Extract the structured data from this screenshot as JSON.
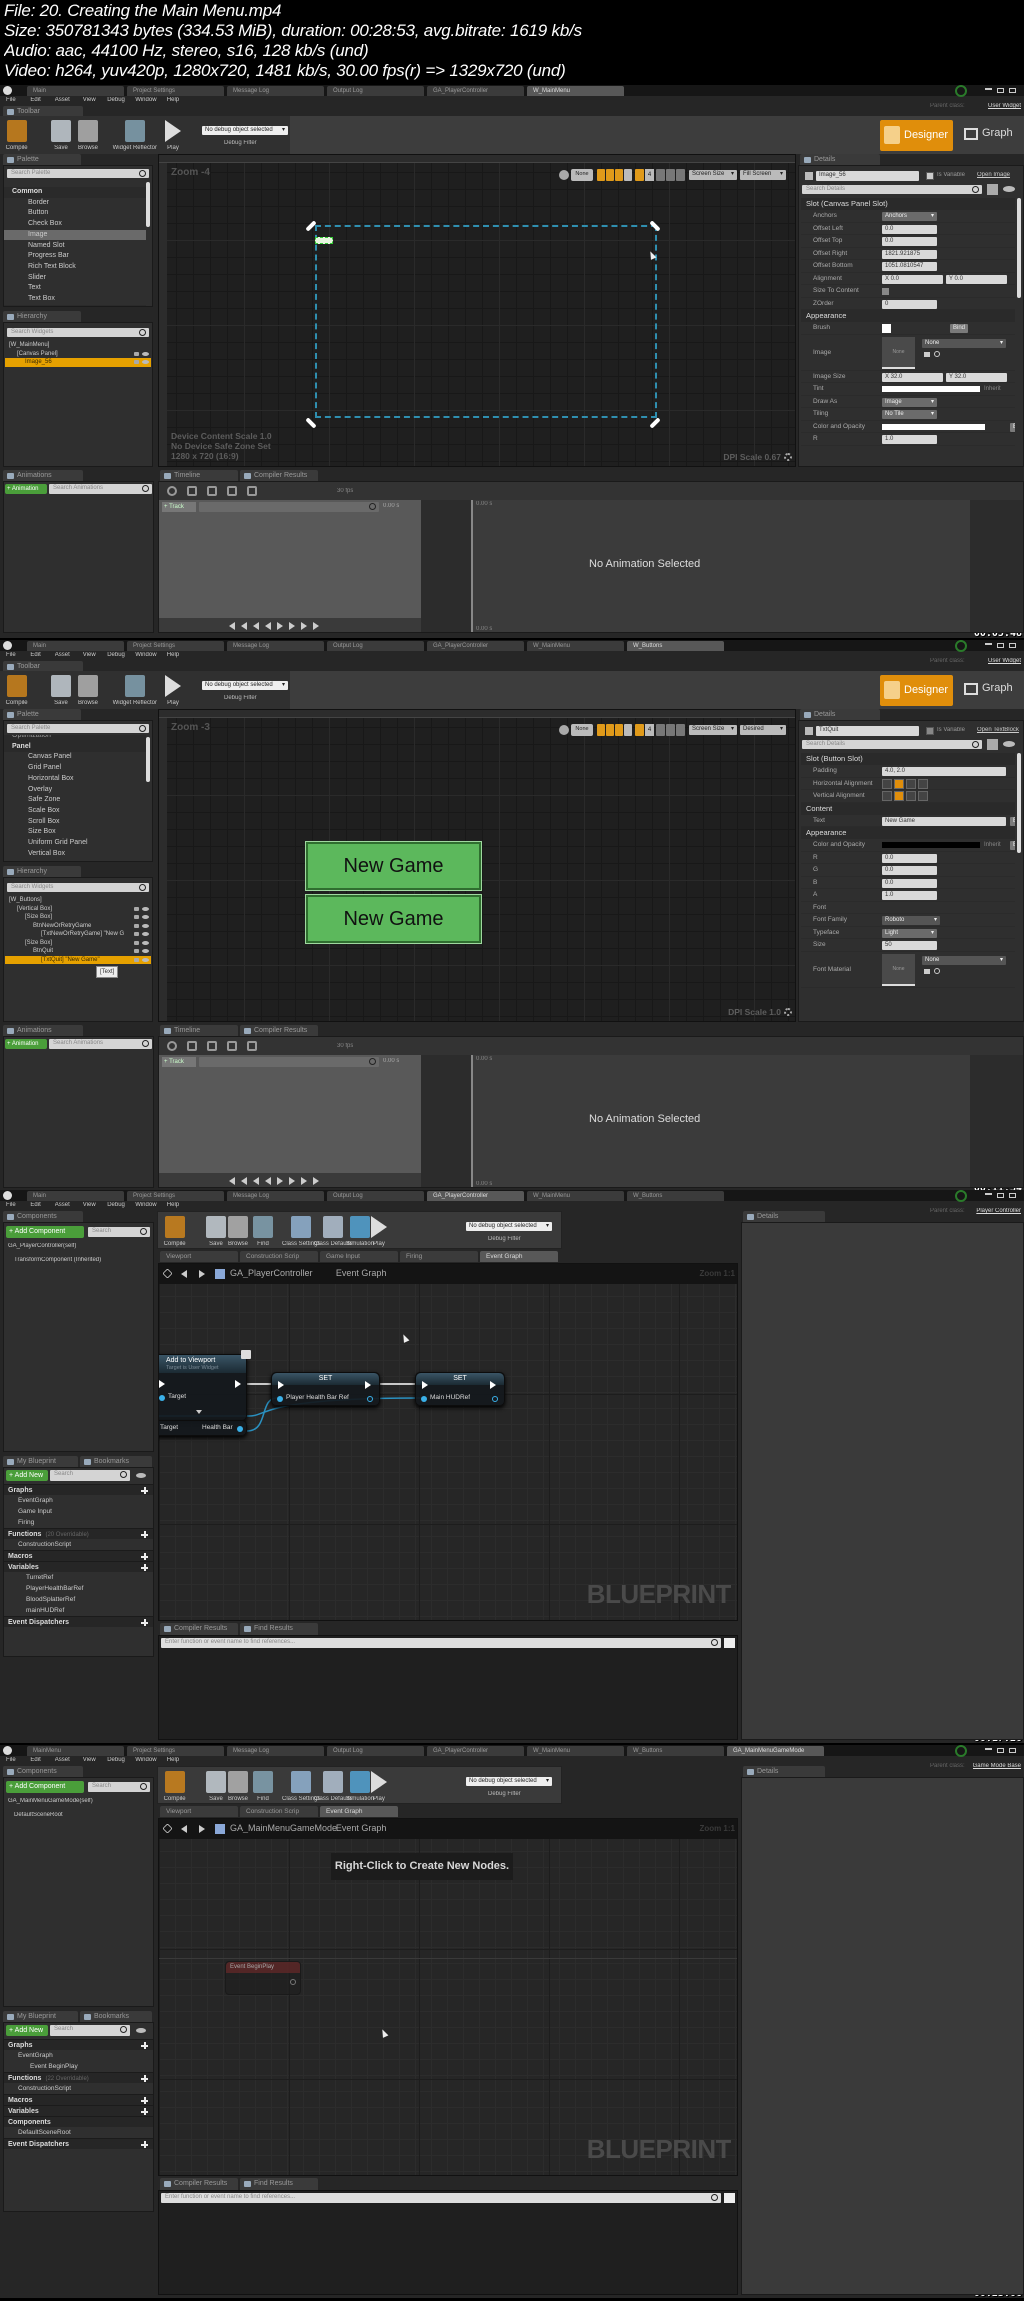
{
  "header": {
    "lines": [
      "File: 20. Creating the Main Menu.mp4",
      "Size: 350781343 bytes (334.53 MiB), duration: 00:28:53, avg.bitrate: 1619 kb/s",
      "Audio: aac, 44100 Hz, stereo, s16, 128 kb/s (und)",
      "Video: h264, yuv420p, 1280x720, 1481 kb/s, 30.00 fps(r) => 1329x720 (und)"
    ]
  },
  "colors": {
    "accent_orange": "#e6a100",
    "button_green": "#5cb85c",
    "pin_blue": "#3ab0e8",
    "selection_dashed": "#2f8fb0"
  },
  "frames": [
    {
      "type": "widget",
      "timestamp": "00:05:48",
      "app_tabs": [
        "Main",
        "Project Settings",
        "Message Log",
        "Output Log",
        "GA_PlayerController",
        "W_MainMenu"
      ],
      "active_tab": 5,
      "menu": [
        "File",
        "Edit",
        "Asset",
        "View",
        "Debug",
        "Window",
        "Help"
      ],
      "parent_class_label": "Parent class:",
      "parent_class": "User Widget",
      "toolbar_tab": "Toolbar",
      "toolbar": [
        "Compile",
        "Save",
        "Browse",
        "Widget Reflector",
        "Play"
      ],
      "debug_dropdown": "No debug object selected",
      "debug_filter": "Debug Filter",
      "modes": {
        "designer": "Designer",
        "graph": "Graph"
      },
      "palette": {
        "tab": "Palette",
        "search": "Search Palette",
        "pre_category": "",
        "category": "Common",
        "items": [
          "Border",
          "Button",
          "Check Box",
          "Image",
          "Named Slot",
          "Progress Bar",
          "Rich Text Block",
          "Slider",
          "Text",
          "Text Box"
        ],
        "selected": 3,
        "next_category": "Input"
      },
      "hierarchy": {
        "tab": "Hierarchy",
        "search": "Search Widgets",
        "tree": [
          {
            "label": "[W_MainMenu]",
            "depth": 0
          },
          {
            "label": "[Canvas Panel]",
            "depth": 1
          },
          {
            "label": "Image_56",
            "depth": 2,
            "selected": true
          }
        ],
        "tooltip": ""
      },
      "canvas": {
        "zoom": "Zoom -4",
        "tools": [
          "None",
          "4",
          "Screen Size",
          "Fill Screen"
        ],
        "info": [
          "Device Content Scale 1.0",
          "No Device Safe Zone Set",
          "1280 x 720 (16:9)"
        ],
        "dpi": "DPI Scale 0.67",
        "buttons": []
      },
      "details": {
        "tab": "Details",
        "name": "Image_56",
        "is_variable": "Is Variable",
        "is_variable_checked": true,
        "open_label": "Open Image",
        "search": "Search Details",
        "rows": [
          {
            "section": "Slot (Canvas Panel Slot)"
          },
          {
            "label": "Anchors",
            "kind": "dropdown",
            "values": [
              "Anchors"
            ]
          },
          {
            "label": "Offset Left",
            "kind": "input",
            "values": [
              "0.0"
            ]
          },
          {
            "label": "Offset Top",
            "kind": "input",
            "values": [
              "0.0"
            ]
          },
          {
            "label": "Offset Right",
            "kind": "input",
            "values": [
              "1821.921875"
            ]
          },
          {
            "label": "Offset Bottom",
            "kind": "input",
            "values": [
              "1051.0810547"
            ]
          },
          {
            "label": "Alignment",
            "kind": "input2",
            "values": [
              "X  0.0",
              "Y  0.0"
            ]
          },
          {
            "label": "Size To Content",
            "kind": "check",
            "values": []
          },
          {
            "label": "ZOrder",
            "kind": "input",
            "values": [
              "0"
            ]
          },
          {
            "section": "Appearance"
          },
          {
            "label": "Brush",
            "kind": "swatch",
            "values": [],
            "bind": "Bind"
          },
          {
            "label": "Image",
            "kind": "thumb",
            "values": [
              "None",
              "None"
            ]
          },
          {
            "label": "Image Size",
            "kind": "input2",
            "values": [
              "X  32.0",
              "Y  32.0"
            ]
          },
          {
            "label": "Tint",
            "kind": "bar-white",
            "values": [],
            "inherit": "Inherit"
          },
          {
            "label": "Draw As",
            "kind": "dropdown",
            "values": [
              "Image"
            ]
          },
          {
            "label": "Tiling",
            "kind": "dropdown",
            "values": [
              "No Tile"
            ]
          },
          {
            "label": "Color and Opacity",
            "kind": "bar-white",
            "values": [],
            "bind": "Bind"
          },
          {
            "label": "R",
            "kind": "input",
            "values": [
              "1.0"
            ]
          }
        ]
      },
      "animations": {
        "tab": "Animations",
        "add": "+ Animation",
        "search": "Search Animations"
      },
      "timeline": {
        "tabs": [
          "Timeline",
          "Compiler Results"
        ],
        "fps": "30 fps",
        "track": "+ Track",
        "time": "0.00 s",
        "empty": "No Animation Selected"
      }
    },
    {
      "type": "widget",
      "timestamp": "00:11:34",
      "app_tabs": [
        "Main",
        "Project Settings",
        "Message Log",
        "Output Log",
        "GA_PlayerController",
        "W_MainMenu",
        "W_Buttons"
      ],
      "active_tab": 6,
      "menu": [
        "File",
        "Edit",
        "Asset",
        "View",
        "Debug",
        "Window",
        "Help"
      ],
      "parent_class_label": "Parent class:",
      "parent_class": "User Widget",
      "toolbar_tab": "Toolbar",
      "toolbar": [
        "Compile",
        "Save",
        "Browse",
        "Widget Reflector",
        "Play"
      ],
      "debug_dropdown": "No debug object selected",
      "debug_filter": "Debug Filter",
      "modes": {
        "designer": "Designer",
        "graph": "Graph"
      },
      "palette": {
        "tab": "Palette",
        "search": "Search Palette",
        "pre_category": "Optimization",
        "category": "Panel",
        "items": [
          "Canvas Panel",
          "Grid Panel",
          "Horizontal Box",
          "Overlay",
          "Safe Zone",
          "Scale Box",
          "Scroll Box",
          "Size Box",
          "Uniform Grid Panel",
          "Vertical Box"
        ],
        "selected": -1,
        "next_category": ""
      },
      "hierarchy": {
        "tab": "Hierarchy",
        "search": "Search Widgets",
        "tree": [
          {
            "label": "[W_Buttons]",
            "depth": 0
          },
          {
            "label": "[Vertical Box]",
            "depth": 1
          },
          {
            "label": "[Size Box]",
            "depth": 2
          },
          {
            "label": "BtnNewOrRetryGame",
            "depth": 3
          },
          {
            "label": "[TxtNewOrRetryGame] \"New G",
            "depth": 4
          },
          {
            "label": "[Size Box]",
            "depth": 2
          },
          {
            "label": "BtnQuit",
            "depth": 3
          },
          {
            "label": "[TxtQuit] \"New Game\"",
            "depth": 4,
            "selected": true
          }
        ],
        "tooltip": "[Text]"
      },
      "canvas": {
        "zoom": "Zoom -3",
        "tools": [
          "None",
          "4",
          "Screen Size",
          "Desired"
        ],
        "info": [],
        "dpi": "DPI Scale 1.0",
        "buttons": [
          "New Game",
          "New Game"
        ]
      },
      "details": {
        "tab": "Details",
        "name": "TxtQuit",
        "is_variable": "Is Variable",
        "is_variable_checked": false,
        "open_label": "Open TextBlock",
        "search": "Search Details",
        "rows": [
          {
            "section": "Slot (Button Slot)"
          },
          {
            "label": "Padding",
            "kind": "wide",
            "values": [
              "4.0, 2.0"
            ]
          },
          {
            "label": "Horizontal Alignment",
            "kind": "align",
            "values": [],
            "active": 1
          },
          {
            "label": "Vertical Alignment",
            "kind": "align",
            "values": [],
            "active": 1
          },
          {
            "section": "Content"
          },
          {
            "label": "Text",
            "kind": "wide",
            "values": [
              "New Game"
            ],
            "bind": "Bind"
          },
          {
            "section": "Appearance"
          },
          {
            "label": "Color and Opacity",
            "kind": "bar-black",
            "values": [],
            "inherit": "Inherit",
            "bind": "Bind"
          },
          {
            "label": "R",
            "kind": "input",
            "values": [
              "0.0"
            ]
          },
          {
            "label": "G",
            "kind": "input",
            "values": [
              "0.0"
            ]
          },
          {
            "label": "B",
            "kind": "input",
            "values": [
              "0.0"
            ]
          },
          {
            "label": "A",
            "kind": "input",
            "values": [
              "1.0"
            ]
          },
          {
            "label": "Font",
            "kind": "none",
            "values": []
          },
          {
            "label": "Font Family",
            "kind": "dropdown-dark",
            "values": [
              "Roboto"
            ]
          },
          {
            "label": "Typeface",
            "kind": "dropdown",
            "values": [
              "Light"
            ]
          },
          {
            "label": "Size",
            "kind": "input",
            "values": [
              "50"
            ]
          },
          {
            "label": "Font Material",
            "kind": "thumb",
            "values": [
              "None",
              "None"
            ]
          }
        ]
      },
      "animations": {
        "tab": "Animations",
        "add": "+ Animation",
        "search": "Search Animations"
      },
      "timeline": {
        "tabs": [
          "Timeline",
          "Compiler Results"
        ],
        "fps": "30 fps",
        "track": "+ Track",
        "time": "0.00 s",
        "empty": "No Animation Selected"
      }
    },
    {
      "type": "blueprint",
      "timestamp": "00:17:20",
      "app_tabs": [
        "Main",
        "Project Settings",
        "Message Log",
        "Output Log",
        "GA_PlayerController",
        "W_MainMenu",
        "W_Buttons"
      ],
      "active_tab": 4,
      "menu": [
        "File",
        "Edit",
        "Asset",
        "View",
        "Debug",
        "Window",
        "Help"
      ],
      "parent_class_label": "Parent class:",
      "parent_class": "Player Controller",
      "toolbar": [
        "Compile",
        "Save",
        "Browse",
        "Find",
        "Class Settings",
        "Class Defaults",
        "Simulation",
        "Play"
      ],
      "debug_dropdown": "No debug object selected",
      "debug_filter": "Debug Filter",
      "components": {
        "tab": "Components",
        "add": "+ Add Component",
        "search": "Search",
        "items": [
          "GA_PlayerController(self)",
          "TransformComponent (Inherited)"
        ]
      },
      "my_blueprint": {
        "tab": "My Blueprint",
        "bookmarks": "Bookmarks",
        "add": "+ Add New",
        "search": "Search",
        "sections": [
          {
            "title": "Graphs",
            "items": [
              "EventGraph",
              "Game Input",
              "Firing"
            ]
          },
          {
            "title": "Functions",
            "note": "(20 Overridable)",
            "items": [
              "ConstructionScript"
            ]
          },
          {
            "title": "Macros",
            "items": []
          },
          {
            "title": "Variables",
            "items": [
              "TurretRef",
              "PlayerHealthBarRef",
              "BloodSplatterRef",
              "mainHUDRef"
            ]
          },
          {
            "title": "Event Dispatchers",
            "items": []
          }
        ]
      },
      "graph_tabs": [
        "Viewport",
        "Construction Scrip",
        "Game Input",
        "Firing",
        "Event Graph"
      ],
      "active_graph_tab": 4,
      "breadcrumb": [
        "GA_PlayerController",
        "Event Graph"
      ],
      "zoom": "Zoom 1:1",
      "watermark": "BLUEPRINT",
      "hint": "",
      "nodes": {
        "add_to_viewport": {
          "title": "Add to Viewport",
          "subtitle": "Target is User Widget",
          "pin": "Target"
        },
        "health": {
          "left": "Target",
          "right": "Health Bar"
        },
        "set1": {
          "title": "SET",
          "pin": "Player Health Bar Ref"
        },
        "set2": {
          "title": "SET",
          "pin": "Main HUDRef"
        }
      },
      "bottom_tabs": [
        "Compiler Results",
        "Find Results"
      ],
      "find_placeholder": "Enter function or event name to find references...",
      "details_tab": "Details"
    },
    {
      "type": "blueprint",
      "timestamp": "00:23:06",
      "app_tabs": [
        "MainMenu",
        "Project Settings",
        "Message Log",
        "Output Log",
        "GA_PlayerController",
        "W_MainMenu",
        "W_Buttons",
        "GA_MainMenuGameMode"
      ],
      "active_tab": 7,
      "menu": [
        "File",
        "Edit",
        "Asset",
        "View",
        "Debug",
        "Window",
        "Help"
      ],
      "parent_class_label": "Parent class:",
      "parent_class": "Game Mode Base",
      "toolbar": [
        "Compile",
        "Save",
        "Browse",
        "Find",
        "Class Settings",
        "Class Defaults",
        "Simulation",
        "Play"
      ],
      "debug_dropdown": "No debug object selected",
      "debug_filter": "Debug Filter",
      "components": {
        "tab": "Components",
        "add": "+ Add Component",
        "search": "Search",
        "items": [
          "GA_MainMenuGameMode(self)",
          "DefaultSceneRoot"
        ]
      },
      "my_blueprint": {
        "tab": "My Blueprint",
        "bookmarks": "Bookmarks",
        "add": "+ Add New",
        "search": "Search",
        "sections": [
          {
            "title": "Graphs",
            "items": [
              "EventGraph",
              "Event BeginPlay"
            ]
          },
          {
            "title": "Functions",
            "note": "(22 Overridable)",
            "items": [
              "ConstructionScript"
            ]
          },
          {
            "title": "Macros",
            "items": []
          },
          {
            "title": "Variables",
            "items": []
          },
          {
            "title": "Components",
            "items": [
              "DefaultSceneRoot"
            ]
          },
          {
            "title": "Event Dispatchers",
            "items": []
          }
        ]
      },
      "graph_tabs": [
        "Viewport",
        "Construction Scrip",
        "Event Graph"
      ],
      "active_graph_tab": 2,
      "breadcrumb": [
        "GA_MainMenuGameMode",
        "Event Graph"
      ],
      "zoom": "Zoom 1:1",
      "watermark": "BLUEPRINT",
      "hint": "Right-Click to Create New Nodes.",
      "nodes": {
        "begin_play": {
          "title": "Event BeginPlay"
        }
      },
      "bottom_tabs": [
        "Compiler Results",
        "Find Results"
      ],
      "find_placeholder": "Enter function or event name to find references...",
      "details_tab": "Details"
    }
  ]
}
